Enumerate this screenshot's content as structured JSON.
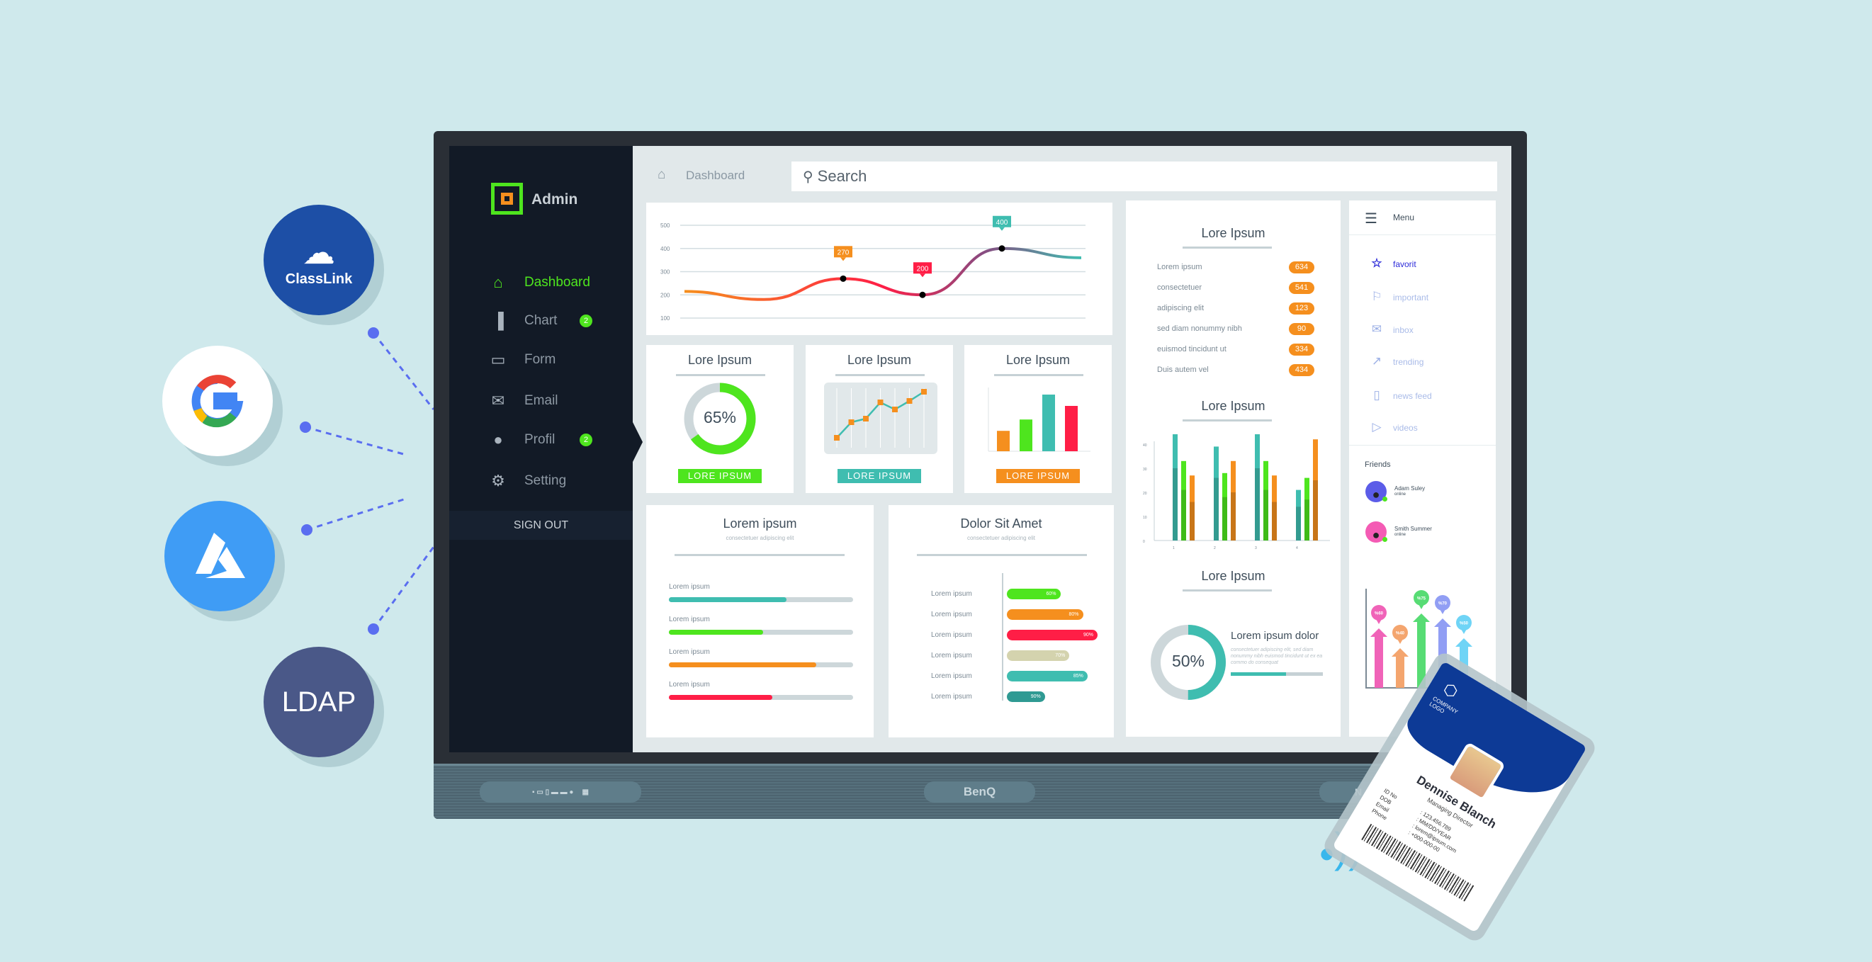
{
  "integrations": [
    {
      "name": "ClassLink",
      "color": "#1d4fa6"
    },
    {
      "name": "Google",
      "color": "#ffffff"
    },
    {
      "name": "Azure",
      "color": "#3f9cf5"
    },
    {
      "name": "LDAP",
      "color": "#4a5888"
    }
  ],
  "monitor": {
    "brand": "BenQ"
  },
  "sidebar": {
    "app_title": "Admin",
    "items": [
      {
        "label": "Dashboard",
        "icon": "home-icon",
        "active": true
      },
      {
        "label": "Chart",
        "icon": "bar-chart-icon",
        "badge": "2"
      },
      {
        "label": "Form",
        "icon": "comment-icon"
      },
      {
        "label": "Email",
        "icon": "envelope-icon"
      },
      {
        "label": "Profil",
        "icon": "user-icon",
        "badge": "2"
      },
      {
        "label": "Setting",
        "icon": "gears-icon"
      }
    ],
    "sign_out": "SIGN OUT"
  },
  "header": {
    "breadcrumb": "Dashboard",
    "search_placeholder": "Search"
  },
  "colors": {
    "green": "#4ee51e",
    "orange": "#f58f1e",
    "teal": "#3fbdb0",
    "red": "#ff1e46",
    "dark_teal": "#2f9a93",
    "sand": "#d4d3ae",
    "sidebar": "#121a26"
  },
  "chart_data": [
    {
      "type": "line",
      "y_ticks": [
        100,
        200,
        300,
        400,
        500
      ],
      "ylim": [
        100,
        500
      ],
      "values": [
        215,
        180,
        270,
        200,
        400,
        360
      ],
      "labels": [
        {
          "index": 2,
          "text": "270",
          "color": "#f58f1e"
        },
        {
          "index": 3,
          "text": "200",
          "color": "#ff1e46"
        },
        {
          "index": 4,
          "text": "400",
          "color": "#3fbdb0"
        }
      ],
      "grid": true
    },
    {
      "type": "bar",
      "categories": [
        "1",
        "2",
        "3",
        "4"
      ],
      "y_ticks": [
        0,
        10,
        20,
        30,
        40
      ],
      "ylim": [
        0,
        50
      ],
      "series": [
        {
          "color": "#3fbdb0",
          "values": [
            45,
            39,
            45,
            21
          ],
          "lower": [
            30,
            26,
            30,
            14
          ]
        },
        {
          "color": "#4ee51e",
          "values": [
            33,
            28,
            33,
            26
          ],
          "lower": [
            21,
            18,
            21,
            17
          ]
        },
        {
          "color": "#f58f1e",
          "values": [
            27,
            33,
            27,
            42
          ],
          "lower": [
            16,
            20,
            16,
            25
          ]
        }
      ]
    },
    {
      "type": "bar",
      "title": "",
      "values": [
        "%60",
        "%40",
        "%75",
        "%70",
        "%50"
      ],
      "numeric": [
        60,
        40,
        75,
        70,
        50
      ],
      "colors": [
        "#f063b8",
        "#f4a56e",
        "#57dc74",
        "#919ef4",
        "#6fd4f6"
      ]
    }
  ],
  "cards": {
    "donut": {
      "title": "Lore Ipsum",
      "value": "65%",
      "fraction": 0.65,
      "button": "LORE IPSUM"
    },
    "mini_line": {
      "title": "Lore Ipsum",
      "values": [
        10,
        32,
        37,
        60,
        50,
        62,
        75
      ],
      "button": "LORE IPSUM"
    },
    "mini_bar": {
      "title": "Lore Ipsum",
      "values": [
        36,
        56,
        100,
        80
      ],
      "colors": [
        "#f58f1e",
        "#4ee51e",
        "#3fbdb0",
        "#ff1e46"
      ],
      "button": "LORE IPSUM"
    },
    "progress": {
      "title": "Lorem ipsum",
      "subtitle": "consectetuer adipiscing elit",
      "items": [
        {
          "label": "Lorem ipsum",
          "fraction": 0.64,
          "color": "#3fbdb0"
        },
        {
          "label": "Lorem ipsum",
          "fraction": 0.51,
          "color": "#4ee51e"
        },
        {
          "label": "Lorem ipsum",
          "fraction": 0.8,
          "color": "#f58f1e"
        },
        {
          "label": "Lorem ipsum",
          "fraction": 0.56,
          "color": "#ff1e46"
        }
      ]
    },
    "hbars": {
      "title": "Dolor Sit Amet",
      "subtitle": "consectetuer adipiscing elit",
      "items": [
        {
          "label": "Lorem ipsum",
          "value": "60%",
          "fill": 0.59,
          "color": "#4ee51e"
        },
        {
          "label": "Lorem ipsum",
          "value": "80%",
          "fill": 0.84,
          "color": "#f58f1e"
        },
        {
          "label": "Lorem ipsum",
          "value": "90%",
          "fill": 1.0,
          "color": "#ff1e46"
        },
        {
          "label": "Lorem ipsum",
          "value": "70%",
          "fill": 0.69,
          "color": "#d4d3ae"
        },
        {
          "label": "Lorem ipsum",
          "value": "85%",
          "fill": 0.89,
          "color": "#3fbdb0"
        },
        {
          "label": "Lorem ipsum",
          "value": "90%",
          "fill": 0.42,
          "color": "#2f9a93"
        }
      ]
    },
    "list": {
      "title": "Lore Ipsum",
      "items": [
        {
          "label": "Lorem ipsum",
          "value": "634"
        },
        {
          "label": "consectetuer",
          "value": "541"
        },
        {
          "label": "adipiscing elit",
          "value": "123"
        },
        {
          "label": "sed diam nonummy nibh",
          "value": "90"
        },
        {
          "label": "euismod tincidunt ut",
          "value": "334"
        },
        {
          "label": "Duis autem vel",
          "value": "434"
        }
      ]
    },
    "grouped": {
      "title": "Lore Ipsum"
    },
    "donut2": {
      "title": "Lore Ipsum",
      "value": "50%",
      "fraction": 0.5,
      "heading": "Lorem ipsum dolor",
      "text": "consectetuer adipiscing elit, sed diam nonummy nibh euismod tincidunt ut  ex ea commo do consequat",
      "bar_fraction": 0.6
    }
  },
  "menu": {
    "title": "Menu",
    "items": [
      {
        "label": "favorit",
        "icon": "star-icon",
        "active": true
      },
      {
        "label": "important",
        "icon": "bookmark-icon"
      },
      {
        "label": "inbox",
        "icon": "inbox-icon"
      },
      {
        "label": "trending",
        "icon": "trending-icon"
      },
      {
        "label": "news feed",
        "icon": "news-icon"
      },
      {
        "label": "videos",
        "icon": "play-icon"
      }
    ],
    "friends_title": "Friends",
    "friends": [
      {
        "name": "Adam Suley",
        "status": "online",
        "color": "#5b5ce8"
      },
      {
        "name": "Smith Summer",
        "status": "online",
        "color": "#f45bb4"
      }
    ]
  },
  "id_card": {
    "logo": "COMPANY LOGO",
    "name": "Dennise Blanch",
    "role": "Managing Director",
    "fields": [
      {
        "k": "ID No",
        "v": ": 123.456.789"
      },
      {
        "k": "DOB",
        "v": ": MM/DD/YEAR"
      },
      {
        "k": "Email",
        "v": ": lorem@ipsum.com"
      },
      {
        "k": "Phone",
        "v": ": +000-000-00"
      }
    ]
  }
}
